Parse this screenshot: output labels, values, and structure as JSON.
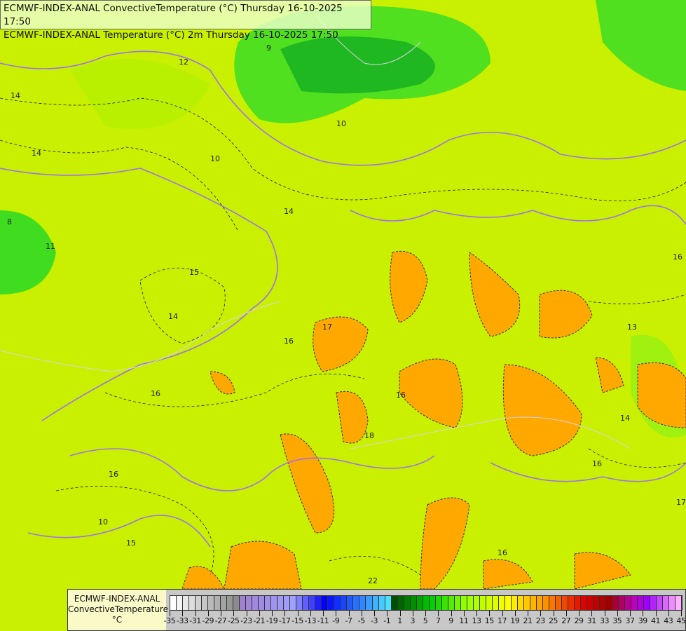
{
  "header": {
    "line1": "ECMWF-INDEX-ANAL ConvectiveTemperature (°C) Thursday 16-10-2025 17:50",
    "line2": "ECMWF-INDEX-ANAL Temperature (°C) 2m Thursday 16-10-2025 17:50"
  },
  "legend": {
    "model": "ECMWF-INDEX-ANAL",
    "parameter": "ConvectiveTemperature",
    "unit": "°C",
    "min": -35,
    "max": 45,
    "step": 1,
    "tick_labels": [
      "-35",
      "-33",
      "-31",
      "-29",
      "-27",
      "-25",
      "-23",
      "-21",
      "-19",
      "-17",
      "-15",
      "-13",
      "-11",
      "-9",
      "-7",
      "-5",
      "-3",
      "-1",
      "1",
      "3",
      "5",
      "7",
      "9",
      "11",
      "13",
      "15",
      "17",
      "19",
      "21",
      "23",
      "25",
      "27",
      "29",
      "31",
      "33",
      "35",
      "37",
      "39",
      "41",
      "43",
      "45"
    ],
    "color_stops": [
      {
        "v": -35,
        "c": "#ffffff"
      },
      {
        "v": -25,
        "c": "#8c8c8c"
      },
      {
        "v": -24,
        "c": "#a080d0"
      },
      {
        "v": -16,
        "c": "#a0a0ff"
      },
      {
        "v": -11,
        "c": "#0000ff"
      },
      {
        "v": -1,
        "c": "#50e0ff"
      },
      {
        "v": 0,
        "c": "#005000"
      },
      {
        "v": 6,
        "c": "#00d000"
      },
      {
        "v": 11,
        "c": "#90ff00"
      },
      {
        "v": 18,
        "c": "#ffff00"
      },
      {
        "v": 24,
        "c": "#ff9000"
      },
      {
        "v": 30,
        "c": "#e00000"
      },
      {
        "v": 34,
        "c": "#a00000"
      },
      {
        "v": 38,
        "c": "#c000c0"
      },
      {
        "v": 40,
        "c": "#a000ff"
      },
      {
        "v": 45,
        "c": "#ffb0ff"
      }
    ]
  },
  "map": {
    "background_color": "#c8f000",
    "contour_labels": [
      "12",
      "14",
      "14",
      "14",
      "9",
      "10",
      "10",
      "8",
      "11",
      "16",
      "15",
      "14",
      "16",
      "16",
      "15",
      "17",
      "16",
      "18",
      "16",
      "13",
      "14",
      "16",
      "17",
      "22",
      "16",
      "10"
    ]
  }
}
